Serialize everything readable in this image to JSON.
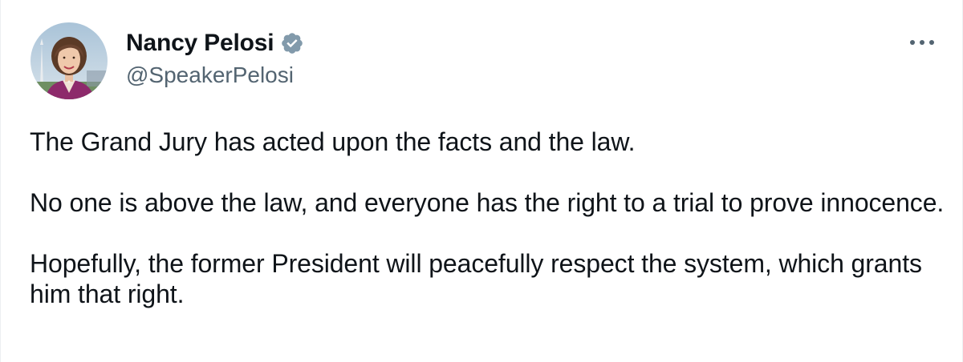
{
  "author": {
    "display_name": "Nancy Pelosi",
    "handle": "@SpeakerPelosi",
    "verified": true,
    "verified_badge_color": "#829aab",
    "avatar_icon": "profile-photo"
  },
  "menu": {
    "icon": "more-horizontal-icon"
  },
  "tweet": {
    "paragraphs": [
      "The Grand Jury has acted upon the facts and the law.",
      "No one is above the law, and everyone has the right to a trial to prove innocence.",
      "Hopefully, the former President will peacefully respect the system, which grants him that right."
    ]
  },
  "colors": {
    "text_primary": "#0f1419",
    "text_secondary": "#536471",
    "background": "#ffffff"
  }
}
